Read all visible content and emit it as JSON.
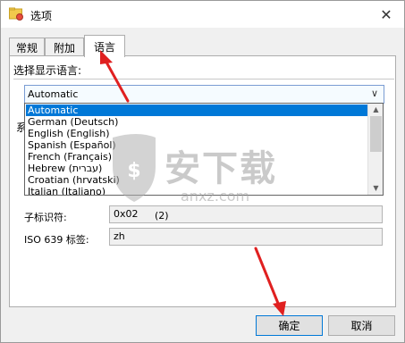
{
  "window": {
    "title": "选项",
    "close_glyph": "✕"
  },
  "tabs": [
    {
      "label": "常规"
    },
    {
      "label": "附加"
    },
    {
      "label": "语言"
    }
  ],
  "active_tab": "语言",
  "language_section": {
    "label": "选择显示语言:",
    "combo_value": "Automatic",
    "combo_arrow": "∨",
    "options": [
      "Automatic",
      "German (Deutsch)",
      "English (English)",
      "Spanish (Español)",
      "French (Français)",
      "Hebrew (עברית)",
      "Croatian (hrvatski)",
      "Italian (Italiano)"
    ],
    "selected_index": 0
  },
  "obscured_text": {
    "left_char": "系"
  },
  "fields": {
    "sublang_label": "子标识符:",
    "sublang_value": "0x02",
    "sublang_extra": "(2)",
    "iso_label": "ISO 639 标签:",
    "iso_value": "zh"
  },
  "buttons": {
    "ok": "确定",
    "cancel": "取消"
  },
  "colors": {
    "selection": "#0078d7",
    "annotation_arrow": "#e02020",
    "panel_bg": "#ffffff",
    "window_bg": "#f0f0f0"
  },
  "watermark_text": "安下载",
  "watermark_sub": "anxz.com"
}
